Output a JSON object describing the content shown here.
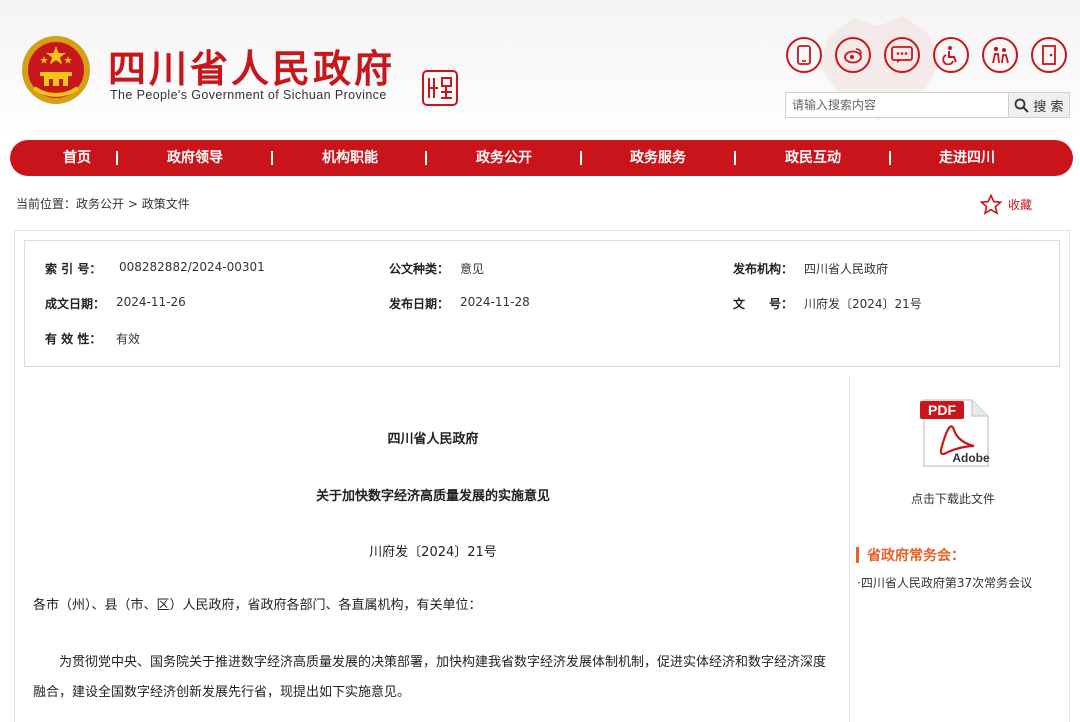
{
  "header": {
    "title": "四川省人民政府",
    "subtitle": "The People's Government of Sichuan Province",
    "search_placeholder": "请输入搜索内容",
    "search_label": "搜 索"
  },
  "tools": [
    {
      "icon": "mobile-icon"
    },
    {
      "icon": "weibo-icon"
    },
    {
      "icon": "message-icon"
    },
    {
      "icon": "accessibility-icon"
    },
    {
      "icon": "elderly-care-icon"
    },
    {
      "icon": "exit-icon"
    }
  ],
  "nav": {
    "items": [
      "首页",
      "政府领导",
      "机构职能",
      "政务公开",
      "政务服务",
      "政民互动",
      "走进四川"
    ]
  },
  "breadcrumb": {
    "prefix": "当前位置：",
    "path1": "政务公开",
    "sep": " > ",
    "path2": "政策文件"
  },
  "favorite_label": "收藏",
  "meta": {
    "index_label": "索 引 号：",
    "index_value": "008282882/2024-00301",
    "doctype_label": "公文种类：",
    "doctype_value": "意见",
    "issuer_label": "发布机构：",
    "issuer_value": "四川省人民政府",
    "written_label": "成文日期：",
    "written_value": "2024-11-26",
    "published_label": "发布日期：",
    "published_value": "2024-11-28",
    "docno_label": "文　　号：",
    "docno_value": "川府发〔2024〕21号",
    "validity_label": "有 效 性：",
    "validity_value": "有效"
  },
  "document": {
    "issuer": "四川省人民政府",
    "title": "关于加快数字经济高质量发展的实施意见",
    "number": "川府发〔2024〕21号",
    "salutation": "各市（州）、县（市、区）人民政府，省政府各部门、各直属机构，有关单位：",
    "body": "为贯彻党中央、国务院关于推进数字经济高质量发展的决策部署，加快构建我省数字经济发展体制机制，促进实体经济和数字经济深度融合，建设全国数字经济创新发展先行省，现提出如下实施意见。"
  },
  "sidebar": {
    "pdf_text": "PDF",
    "pdf_brand": "Adobe",
    "download_label": "点击下载此文件",
    "section_title": "省政府常务会：",
    "meeting_item": "·四川省人民政府第37次常务会议"
  },
  "colors": {
    "brand_red": "#c8161d",
    "accent_orange": "#e8612c"
  }
}
